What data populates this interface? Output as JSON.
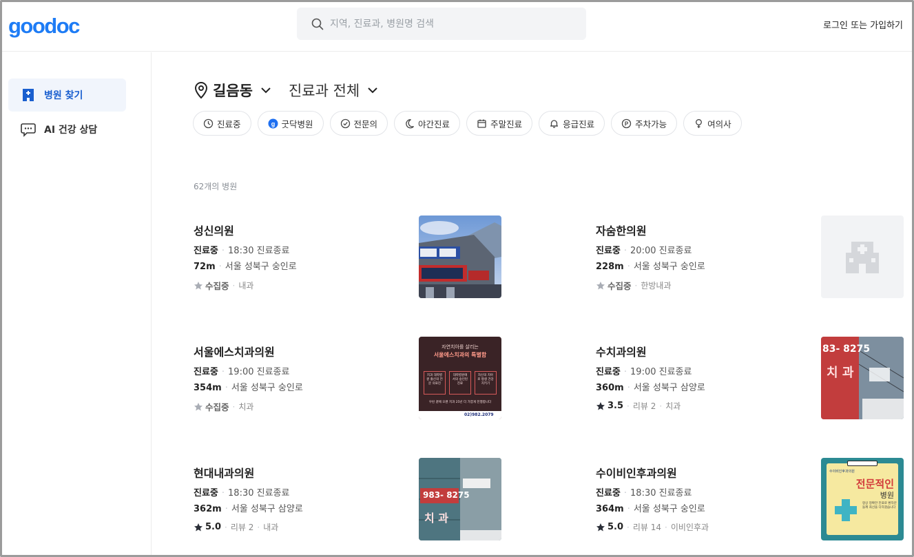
{
  "header": {
    "logo": "goodoc",
    "search_placeholder": "지역, 진료과, 병원명 검색",
    "login_label": "로그인 또는 가입하기"
  },
  "sidebar": {
    "items": [
      {
        "label": "병원 찾기",
        "icon": "hospital-icon",
        "active": true
      },
      {
        "label": "AI 건강 상담",
        "icon": "chat-icon",
        "active": false
      }
    ]
  },
  "location": {
    "name": "길음동",
    "department": "진료과 전체"
  },
  "filters": [
    {
      "label": "진료중",
      "icon": "clock-icon"
    },
    {
      "label": "굿닥병원",
      "icon": "goodoc-badge-icon"
    },
    {
      "label": "전문의",
      "icon": "check-circle-icon"
    },
    {
      "label": "야간진료",
      "icon": "moon-icon"
    },
    {
      "label": "주말진료",
      "icon": "calendar-icon"
    },
    {
      "label": "응급진료",
      "icon": "bell-icon"
    },
    {
      "label": "주차가능",
      "icon": "parking-icon"
    },
    {
      "label": "여의사",
      "icon": "female-icon"
    }
  ],
  "result_count": "62개의 병원",
  "hospitals": [
    {
      "name": "성신의원",
      "status": "진료중",
      "hours": "18:30 진료종료",
      "distance": "72m",
      "address": "서울 성북구 숭인로",
      "rating": "수집중",
      "reviews": "",
      "dept": "내과",
      "thumb": "building-photo"
    },
    {
      "name": "자숨한의원",
      "status": "진료중",
      "hours": "20:00 진료종료",
      "distance": "228m",
      "address": "서울 성북구 숭인로",
      "rating": "수집중",
      "reviews": "",
      "dept": "한방내과",
      "thumb": "placeholder-hospital"
    },
    {
      "name": "서울에스치과의원",
      "status": "진료중",
      "hours": "19:00 진료종료",
      "distance": "354m",
      "address": "서울 성북구 숭인로",
      "rating": "수집중",
      "reviews": "",
      "dept": "치과",
      "thumb": "promo-poster",
      "poster": {
        "line1": "자연치아를 살리는",
        "line2": "서울에스치과의 특별함",
        "box1": "치과 대학병원 출신의 전문 의료진",
        "box2": "대학병원에서의 숭인된 진료",
        "box3": "자신의 치아로 평생 건강 지키기",
        "bottom": "우린 곁에 오랜 치과 25년 더 가깝게 진행합니다",
        "phone": "02)982.2079"
      }
    },
    {
      "name": "수치과의원",
      "status": "진료중",
      "hours": "19:00 진료종료",
      "distance": "360m",
      "address": "서울 성북구 삼양로",
      "rating": "3.5",
      "reviews": "리뷰 2",
      "dept": "치과",
      "thumb": "sign-photo",
      "sign": {
        "number": "83- 8275",
        "text": "치 과"
      }
    },
    {
      "name": "현대내과의원",
      "status": "진료중",
      "hours": "18:30 진료종료",
      "distance": "362m",
      "address": "서울 성북구 삼양로",
      "rating": "5.0",
      "reviews": "리뷰 2",
      "dept": "내과",
      "thumb": "sign-photo-2",
      "sign": {
        "number": "983- 8275",
        "text": "치 과"
      }
    },
    {
      "name": "수이비인후과의원",
      "status": "진료중",
      "hours": "18:30 진료종료",
      "distance": "364m",
      "address": "서울 성북구 숭인로",
      "rating": "5.0",
      "reviews": "리뷰 14",
      "dept": "이비인후과",
      "thumb": "clinic-board",
      "board": {
        "top": "수이비인후과의원",
        "title": "전문적인",
        "sub": "병원",
        "body": "항상 정확한 진료로 환자분들께 최선을 다하겠습니다"
      }
    }
  ],
  "colors": {
    "brand": "#1e7cf5",
    "active_nav_bg": "#f1f5fc",
    "active_nav_text": "#1a5fcf"
  }
}
